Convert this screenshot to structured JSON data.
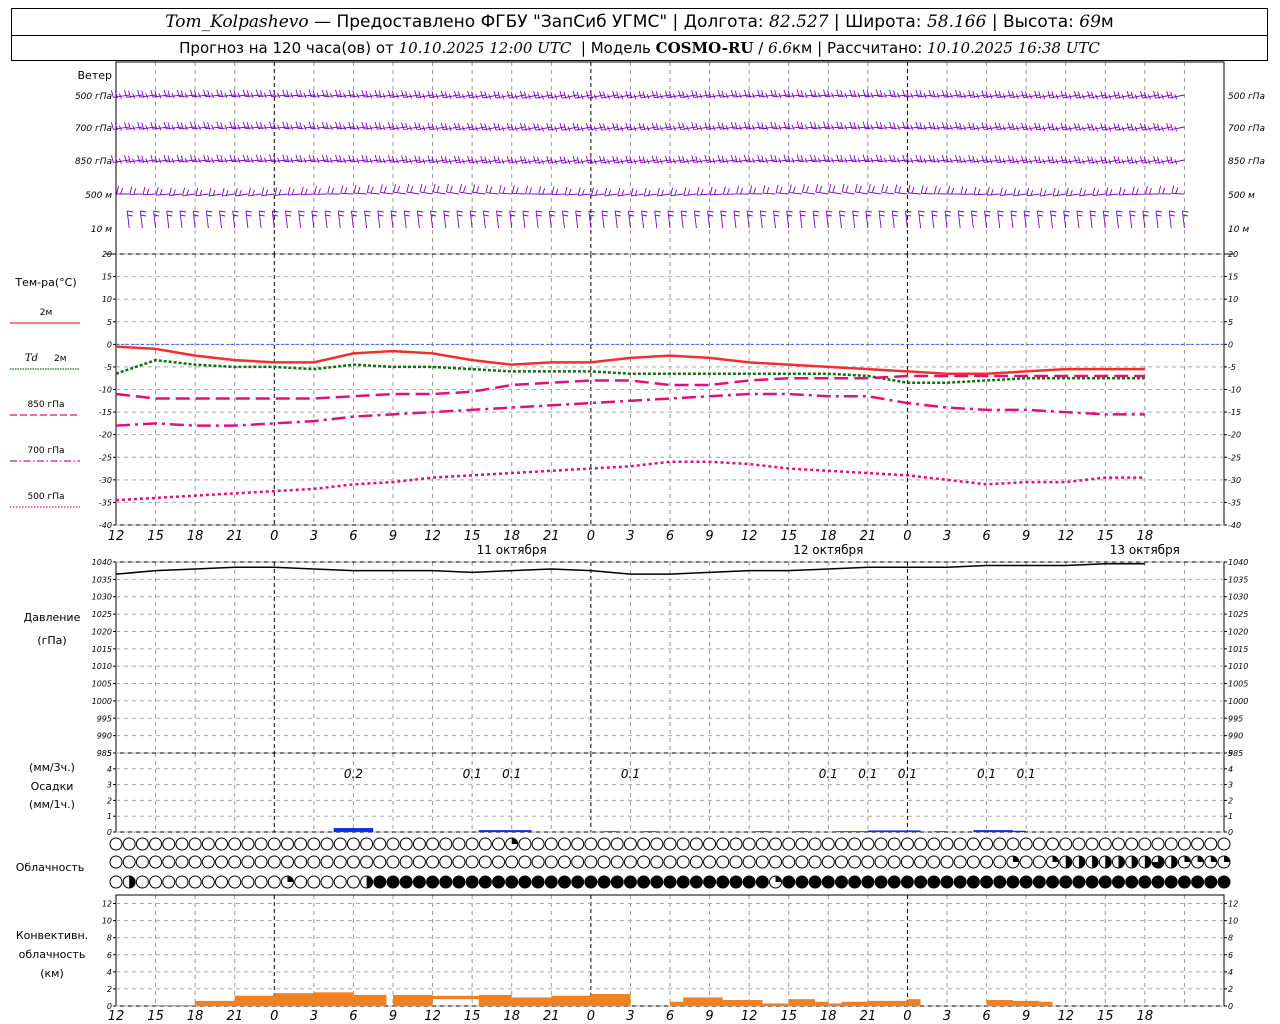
{
  "header": {
    "station": "Tom_Kolpashevo",
    "provider": "Предоставлено ФГБУ \"ЗапСиб УГМС\"",
    "lon_label": "Долгота:",
    "lon": "82.527",
    "lat_label": "Широта:",
    "lat": "58.166",
    "alt_label": "Высота:",
    "alt": "69",
    "alt_unit": "м",
    "forecast_label": "Прогноз на 120 часа(ов) от",
    "forecast_start": "10.10.2025 12:00 UTC",
    "model_label": "Модель",
    "model": "COSMO-RU",
    "resolution": "6.6",
    "res_unit": "км",
    "computed_label": "Рассчитано:",
    "computed": "10.10.2025 16:38 UTC"
  },
  "colors": {
    "wind": "#8000c0",
    "t2m": "#f03030",
    "td2m": "#107010",
    "level": "#e0107a",
    "precip": "#1030e0",
    "conv": "#f08020",
    "zero_line": "#4060e0"
  },
  "chart_data": [
    {
      "type": "wind_barbs",
      "title": "Ветер",
      "levels": [
        "500 гПа",
        "700 гПа",
        "850 гПа",
        "500 м",
        "10 м"
      ]
    },
    {
      "type": "line",
      "ylabel": "Тем-ра(°C)",
      "ylim": [
        -40,
        20
      ],
      "yticks": [
        20,
        15,
        10,
        5,
        0,
        -5,
        -10,
        -15,
        -20,
        -25,
        -30,
        -35,
        -40
      ],
      "x_hours": [
        0,
        3,
        6,
        9,
        12,
        15,
        18,
        21,
        24,
        27,
        30,
        33,
        36,
        39,
        42,
        45,
        48,
        51,
        54,
        57,
        60,
        63,
        66,
        69,
        72,
        75,
        78
      ],
      "series": [
        {
          "name": "2м",
          "values": [
            -0.5,
            -1,
            -2.5,
            -3.5,
            -4,
            -4,
            -2,
            -1.5,
            -2,
            -3.5,
            -4.5,
            -4,
            -4,
            -3,
            -2.5,
            -3,
            -4,
            -4.5,
            -5,
            -5.5,
            -6,
            -6.5,
            -6.5,
            -6,
            -5.5,
            -5.5,
            -5.5
          ]
        },
        {
          "name": "Td 2м",
          "values": [
            -6.5,
            -3.5,
            -4.5,
            -5,
            -5,
            -5.5,
            -4.5,
            -5,
            -5,
            -5.5,
            -6,
            -6,
            -6,
            -6.5,
            -6.5,
            -6.5,
            -6.5,
            -6.5,
            -6.5,
            -7,
            -8.5,
            -8.5,
            -8,
            -7.5,
            -7.5,
            -7.5,
            -7.5
          ]
        },
        {
          "name": "850 гПа",
          "values": [
            -11,
            -12,
            -12,
            -12,
            -12,
            -12,
            -11.5,
            -11,
            -11,
            -10.5,
            -9,
            -8.5,
            -8,
            -8,
            -9,
            -9,
            -8,
            -7.5,
            -7.5,
            -7.5,
            -7,
            -7,
            -7,
            -7,
            -7,
            -7,
            -7
          ]
        },
        {
          "name": "700 гПа",
          "values": [
            -18,
            -17.5,
            -18,
            -18,
            -17.5,
            -17,
            -16,
            -15.5,
            -15,
            -14.5,
            -14,
            -13.5,
            -13,
            -12.5,
            -12,
            -11.5,
            -11,
            -11,
            -11.5,
            -11.5,
            -13,
            -14,
            -14.5,
            -14.5,
            -15,
            -15.5,
            -15.5
          ]
        },
        {
          "name": "500 гПа",
          "values": [
            -34.5,
            -34,
            -33.5,
            -33,
            -32.5,
            -32,
            -31,
            -30.5,
            -29.5,
            -29,
            -28.5,
            -28,
            -27.5,
            -27,
            -26,
            -26,
            -26.5,
            -27.5,
            -28,
            -28.5,
            -29,
            -30,
            -31,
            -30.5,
            -30.5,
            -29.5,
            -29.5
          ]
        }
      ]
    },
    {
      "type": "line",
      "ylabel": "Давление",
      "ylabel2": "(гПа)",
      "ylim": [
        985,
        1040
      ],
      "yticks": [
        1040,
        1035,
        1030,
        1025,
        1020,
        1015,
        1010,
        1005,
        1000,
        995,
        990,
        985
      ],
      "values": [
        1036.5,
        1037.5,
        1038,
        1038.5,
        1038.5,
        1038,
        1037.5,
        1037.5,
        1037.5,
        1037,
        1037.5,
        1038,
        1037.5,
        1036.5,
        1036.5,
        1037,
        1037.5,
        1037.5,
        1038,
        1038.5,
        1038.5,
        1038.5,
        1039,
        1039,
        1039,
        1039.5,
        1039.5
      ]
    },
    {
      "type": "bar",
      "ylabel_top": "(мм/3ч.)",
      "ylabel": "Осадки",
      "ylabel_bottom": "(мм/1ч.)",
      "ylim": [
        0,
        5
      ],
      "yticks": [
        5,
        4,
        3,
        2,
        1,
        0
      ],
      "labels": [
        {
          "hour": 30,
          "text": "0.2"
        },
        {
          "hour": 39,
          "text": "0.1"
        },
        {
          "hour": 42,
          "text": "0.1"
        },
        {
          "hour": 51,
          "text": "0.1"
        },
        {
          "hour": 66,
          "text": "0.1"
        },
        {
          "hour": 69,
          "text": "0.1"
        },
        {
          "hour": 72,
          "text": "0.1"
        },
        {
          "hour": 78,
          "text": "0.1"
        },
        {
          "hour": 81,
          "text": "0.1"
        }
      ],
      "bars": [
        {
          "start": 28.5,
          "end": 31.5,
          "value": 0.25
        },
        {
          "start": 39.5,
          "end": 43.5,
          "value": 0.12
        },
        {
          "start": 49,
          "end": 50,
          "value": 0.05
        },
        {
          "start": 52,
          "end": 53,
          "value": 0.05
        },
        {
          "start": 60.5,
          "end": 61.5,
          "value": 0.05
        },
        {
          "start": 63.5,
          "end": 64.5,
          "value": 0.05
        },
        {
          "start": 66.5,
          "end": 69,
          "value": 0.05
        },
        {
          "start": 69,
          "end": 73,
          "value": 0.1
        },
        {
          "start": 74,
          "end": 75,
          "value": 0.05
        },
        {
          "start": 77,
          "end": 80,
          "value": 0.12
        },
        {
          "start": 80,
          "end": 81,
          "value": 0.08
        }
      ]
    },
    {
      "type": "cloud_symbols",
      "ylabel": "Облачность",
      "rows": [
        {
          "name": "upper",
          "cover": [
            0,
            0,
            0,
            0,
            0,
            0,
            0,
            0,
            0,
            0,
            0,
            0,
            0,
            0,
            0,
            0,
            0,
            0,
            0,
            0,
            0,
            0,
            0,
            0,
            0,
            0,
            0,
            0,
            0,
            0,
            1,
            0,
            0,
            0,
            0,
            0,
            0,
            0,
            0,
            0,
            0,
            0,
            0,
            0,
            0,
            0,
            0,
            0,
            0,
            0,
            0,
            0,
            0,
            0,
            0,
            0,
            0,
            0,
            0,
            0,
            0,
            0,
            0,
            0,
            0,
            0,
            0,
            0,
            0,
            0,
            0,
            0,
            0,
            0,
            0,
            0,
            0,
            0,
            0,
            0,
            0,
            0,
            0,
            0,
            0
          ]
        },
        {
          "name": "middle",
          "cover": [
            0,
            0,
            0,
            0,
            0,
            0,
            0,
            0,
            0,
            0,
            0,
            0,
            0,
            0,
            0,
            0,
            0,
            0,
            0,
            0,
            0,
            0,
            0,
            0,
            0,
            0,
            0,
            0,
            0,
            0,
            0,
            0,
            0,
            0,
            0,
            0,
            0,
            0,
            0,
            0,
            0,
            0,
            0,
            0,
            0,
            0,
            0,
            0,
            0,
            0,
            0,
            0,
            0,
            0,
            0,
            0,
            0,
            0,
            0,
            0,
            0,
            0,
            0,
            0,
            0,
            0,
            0,
            0,
            1,
            0,
            0,
            1,
            2,
            2,
            2,
            2,
            2,
            2,
            2,
            3,
            2,
            1,
            1,
            1,
            1
          ]
        },
        {
          "name": "low",
          "cover": [
            0,
            2,
            0,
            0,
            0,
            0,
            0,
            0,
            0,
            0,
            0,
            0,
            0,
            1,
            0,
            0,
            0,
            0,
            0,
            2,
            4,
            4,
            4,
            4,
            4,
            4,
            4,
            4,
            4,
            4,
            4,
            4,
            4,
            4,
            4,
            4,
            4,
            4,
            4,
            4,
            4,
            4,
            4,
            4,
            4,
            4,
            4,
            4,
            4,
            4,
            1,
            4,
            4,
            4,
            4,
            4,
            4,
            4,
            4,
            4,
            4,
            4,
            4,
            4,
            4,
            4,
            4,
            4,
            4,
            4,
            4,
            4,
            4,
            4,
            4,
            4,
            4,
            4,
            4,
            4,
            4,
            4,
            4,
            4,
            4
          ]
        }
      ]
    },
    {
      "type": "bar",
      "ylabel": "Конвективн.",
      "ylabel2": "облачность",
      "ylabel3": "(км)",
      "ylim": [
        0,
        13
      ],
      "yticks": [
        12,
        10,
        8,
        6,
        4,
        2,
        0
      ],
      "bars": [
        {
          "start": 15,
          "end": 18,
          "value": 0.1,
          "base": 0
        },
        {
          "start": 18,
          "end": 21,
          "value": 0.6,
          "base": 0
        },
        {
          "start": 21,
          "end": 24,
          "value": 1.2,
          "base": 0
        },
        {
          "start": 24,
          "end": 27,
          "value": 1.5,
          "base": 0
        },
        {
          "start": 27,
          "end": 30,
          "value": 1.6,
          "base": 0
        },
        {
          "start": 30,
          "end": 32.5,
          "value": 1.3,
          "base": 0
        },
        {
          "start": 32.5,
          "end": 33,
          "value": 0.0,
          "base": 0
        },
        {
          "start": 33,
          "end": 36,
          "value": 1.3,
          "base": 0
        },
        {
          "start": 36,
          "end": 39.5,
          "value": 1.2,
          "base": 0.8
        },
        {
          "start": 39.5,
          "end": 42,
          "value": 1.3,
          "base": 0
        },
        {
          "start": 42,
          "end": 45,
          "value": 1.0,
          "base": 0
        },
        {
          "start": 45,
          "end": 48,
          "value": 1.2,
          "base": 0
        },
        {
          "start": 48,
          "end": 51,
          "value": 1.4,
          "base": 0
        },
        {
          "start": 54,
          "end": 55,
          "value": 0.5,
          "base": 0
        },
        {
          "start": 55,
          "end": 58,
          "value": 1.0,
          "base": 0
        },
        {
          "start": 58,
          "end": 61,
          "value": 0.7,
          "base": 0
        },
        {
          "start": 61,
          "end": 63,
          "value": 0.3,
          "base": 0
        },
        {
          "start": 63,
          "end": 65,
          "value": 0.8,
          "base": 0
        },
        {
          "start": 65,
          "end": 66,
          "value": 0.5,
          "base": 0
        },
        {
          "start": 66,
          "end": 67,
          "value": 0.3,
          "base": 0
        },
        {
          "start": 67,
          "end": 69,
          "value": 0.5,
          "base": 0
        },
        {
          "start": 69,
          "end": 72,
          "value": 0.6,
          "base": 0
        },
        {
          "start": 72,
          "end": 73,
          "value": 0.8,
          "base": 0
        },
        {
          "start": 78,
          "end": 80,
          "value": 0.7,
          "base": 0
        },
        {
          "start": 80,
          "end": 82,
          "value": 0.6,
          "base": 0
        },
        {
          "start": 82,
          "end": 83,
          "value": 0.5,
          "base": 0
        }
      ]
    }
  ],
  "legend": {
    "t2m_label": "2м",
    "td_label_italic": "Td",
    "td_label": "2м",
    "l850_label": "850 гПа",
    "l700_label": "700 гПа",
    "l500_label": "500 гПа"
  },
  "time_axis": {
    "hour_labels": [
      "12",
      "15",
      "18",
      "21",
      "0",
      "3",
      "6",
      "9",
      "12",
      "15",
      "18",
      "21",
      "0",
      "3",
      "6",
      "9",
      "12",
      "15",
      "18",
      "21",
      "0",
      "3",
      "6",
      "9",
      "12",
      "15",
      "18"
    ],
    "day_labels": [
      {
        "hour": 42,
        "text": "11 октября"
      },
      {
        "hour": 66,
        "text": "12 октября"
      },
      {
        "hour": 90,
        "text": "13 октября"
      }
    ]
  }
}
